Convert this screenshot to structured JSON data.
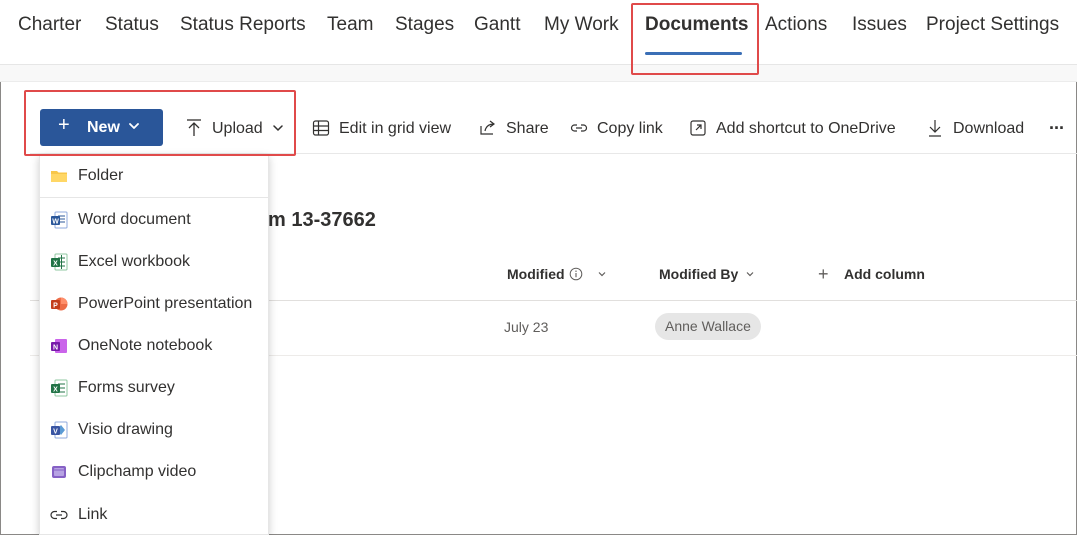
{
  "nav": {
    "tabs": [
      {
        "label": "Charter"
      },
      {
        "label": "Status"
      },
      {
        "label": "Status Reports"
      },
      {
        "label": "Team"
      },
      {
        "label": "Stages"
      },
      {
        "label": "Gantt"
      },
      {
        "label": "My Work"
      },
      {
        "label": "Documents",
        "active": true
      },
      {
        "label": "Actions"
      },
      {
        "label": "Issues"
      },
      {
        "label": "Project Settings"
      }
    ]
  },
  "toolbar": {
    "new_label": "New",
    "upload_label": "Upload",
    "edit_grid_label": "Edit in grid view",
    "share_label": "Share",
    "copy_link_label": "Copy link",
    "add_shortcut_label": "Add shortcut to OneDrive",
    "download_label": "Download",
    "more_label": "..."
  },
  "new_menu": {
    "items": [
      {
        "label": "Folder",
        "icon": "folder-icon"
      },
      {
        "label": "Word document",
        "icon": "word-icon"
      },
      {
        "label": "Excel workbook",
        "icon": "excel-icon"
      },
      {
        "label": "PowerPoint presentation",
        "icon": "powerpoint-icon"
      },
      {
        "label": "OneNote notebook",
        "icon": "onenote-icon"
      },
      {
        "label": "Forms survey",
        "icon": "forms-icon"
      },
      {
        "label": "Visio drawing",
        "icon": "visio-icon"
      },
      {
        "label": "Clipchamp video",
        "icon": "clipchamp-icon"
      },
      {
        "label": "Link",
        "icon": "link-icon"
      }
    ]
  },
  "library": {
    "title_visible": "m 13-37662",
    "columns": {
      "modified": "Modified",
      "modified_by": "Modified By",
      "add_column": "Add column"
    },
    "rows": [
      {
        "modified": "July 23",
        "modified_by": "Anne Wallace"
      }
    ]
  },
  "colors": {
    "accent_blue": "#2a5699",
    "tab_underline": "#3b6fb6",
    "highlight_red": "#e04a4a"
  }
}
